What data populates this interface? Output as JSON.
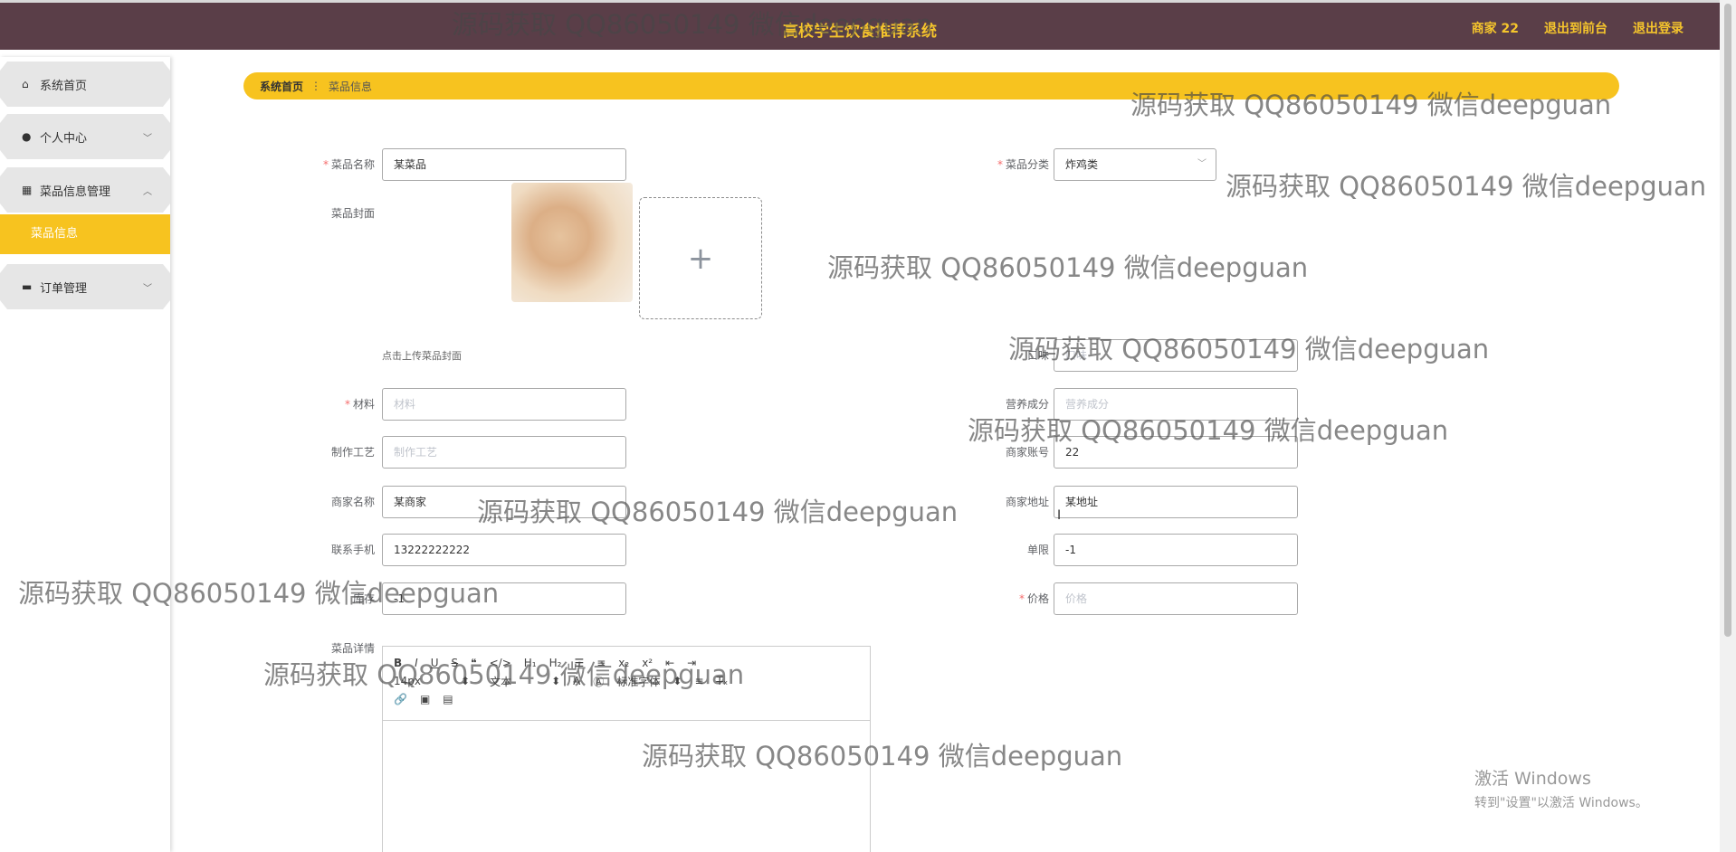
{
  "header": {
    "app_title": "高校学生饮食推荐系统",
    "links": [
      "商家 22",
      "退出到前台",
      "退出登录"
    ]
  },
  "sidebar": {
    "items": [
      {
        "icon": "home-icon",
        "label": "系统首页"
      },
      {
        "icon": "user-icon",
        "label": "个人中心"
      },
      {
        "icon": "grid-icon",
        "label": "菜品信息管理"
      },
      {
        "icon": "monitor-icon",
        "label": "订单管理"
      }
    ],
    "active_sub": "菜品信息"
  },
  "breadcrumb": {
    "home": "系统首页",
    "current": "菜品信息"
  },
  "form": {
    "name": {
      "label": "菜品名称",
      "value": "某菜品"
    },
    "category": {
      "label": "菜品分类",
      "value": "炸鸡类"
    },
    "cover": {
      "label": "菜品封面",
      "hint": "点击上传菜品封面",
      "upload_plus": "+"
    },
    "taste": {
      "label": "口味",
      "placeholder": "口味"
    },
    "material": {
      "label": "材料",
      "placeholder": "材料"
    },
    "nutrition": {
      "label": "营养成分",
      "placeholder": "营养成分"
    },
    "process": {
      "label": "制作工艺",
      "placeholder": "制作工艺"
    },
    "merchant_account": {
      "label": "商家账号",
      "value": "22"
    },
    "merchant_name": {
      "label": "商家名称",
      "value": "某商家"
    },
    "merchant_address": {
      "label": "商家地址",
      "value": "某地址"
    },
    "phone": {
      "label": "联系手机",
      "value": "13222222222"
    },
    "limit": {
      "label": "单限",
      "value": "-1"
    },
    "stock": {
      "label": "库存",
      "value": "-1"
    },
    "price": {
      "label": "价格",
      "placeholder": "价格"
    },
    "detail": {
      "label": "菜品详情",
      "font_size": "14px",
      "text_type": "文本",
      "font_family": "标准字体"
    }
  },
  "watermark": "源码获取 QQ86050149 微信deepguan",
  "windows_activation": {
    "line1": "激活 Windows",
    "line2": "转到\"设置\"以激活 Windows。"
  },
  "colors": {
    "header_bg": "#5a3e48",
    "accent": "#f7c31f",
    "required": "#f56c6c"
  }
}
